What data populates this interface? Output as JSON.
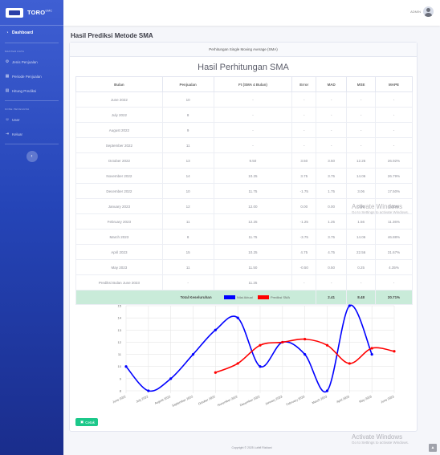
{
  "brand": {
    "name": "TORO",
    "suffix": "GMC"
  },
  "sidebar": {
    "dashboard": "Dashboard",
    "heading_master": "MASTER DATA",
    "items_master": [
      "Jenis Penjualan",
      "Periode Penjualan",
      "Hitung Prediksi"
    ],
    "heading_user": "KONE PENGGUNA",
    "items_user": [
      "User",
      "Keluar"
    ]
  },
  "topbar": {
    "user": "ADMIN"
  },
  "page_title": "Hasil Prediksi Metode SMA",
  "card": {
    "header": "Perhitungan Single Moving Average (SMA)",
    "title": "Hasil Perhitungan SMA"
  },
  "table": {
    "headers": [
      "Bulan",
      "Penjualan",
      "Ft (SMA 4 Bulan)",
      "Error",
      "MAD",
      "MSE",
      "MAPE"
    ],
    "rows": [
      [
        "June 2022",
        "10",
        "-",
        "-",
        "-",
        "-",
        "-"
      ],
      [
        "July 2022",
        "8",
        "-",
        "-",
        "-",
        "-",
        "-"
      ],
      [
        "August 2022",
        "9",
        "-",
        "-",
        "-",
        "-",
        "-"
      ],
      [
        "September 2022",
        "11",
        "-",
        "-",
        "-",
        "-",
        "-"
      ],
      [
        "October 2022",
        "13",
        "9.50",
        "3.50",
        "3.50",
        "12.25",
        "26.92%"
      ],
      [
        "November 2022",
        "14",
        "10.25",
        "3.75",
        "3.75",
        "14.06",
        "26.79%"
      ],
      [
        "December 2022",
        "10",
        "11.75",
        "-1.75",
        "1.75",
        "3.06",
        "17.50%"
      ],
      [
        "January 2023",
        "12",
        "12.00",
        "0.00",
        "0.00",
        "0.00",
        "0.00%"
      ],
      [
        "February 2023",
        "11",
        "12.25",
        "-1.25",
        "1.25",
        "1.56",
        "11.36%"
      ],
      [
        "March 2023",
        "8",
        "11.75",
        "-3.75",
        "3.75",
        "14.06",
        "46.88%"
      ],
      [
        "April 2023",
        "15",
        "10.25",
        "4.75",
        "4.75",
        "22.56",
        "31.67%"
      ],
      [
        "May 2023",
        "11",
        "11.50",
        "-0.50",
        "0.50",
        "0.25",
        "4.35%"
      ],
      [
        "Prediksi Bulan June 2023",
        "-",
        "11.25",
        "-",
        "-",
        "-",
        "-"
      ]
    ],
    "total": {
      "label": "Total Keseluruhan",
      "mad": "2.41",
      "mse": "8.48",
      "mape": "20.71%"
    }
  },
  "chart_data": {
    "type": "line",
    "x": [
      "June 2022",
      "July 2022",
      "August 2022",
      "September 2022",
      "October 2022",
      "November 2022",
      "December 2022",
      "January 2023",
      "February 2023",
      "March 2023",
      "April 2023",
      "May 2023",
      "June 2023"
    ],
    "series": [
      {
        "name": "Nilai Aktual",
        "color": "#0000ff",
        "values": [
          10,
          8,
          9,
          11,
          13,
          14,
          10,
          12,
          11,
          8,
          15,
          11,
          null
        ]
      },
      {
        "name": "Prediksi SMA",
        "color": "#ff0000",
        "values": [
          null,
          null,
          null,
          null,
          9.5,
          10.25,
          11.75,
          12,
          12.25,
          11.75,
          10.25,
          11.5,
          11.25
        ]
      }
    ],
    "ylim": [
      8,
      15
    ],
    "yticks": [
      "8",
      "9",
      "10",
      "11",
      "12",
      "13",
      "14",
      "15"
    ],
    "grid": true,
    "legend": "top"
  },
  "buttons": {
    "cetak": "Cetak"
  },
  "footer": "Copyright © 2025 Luthfi Rizkiani",
  "watermark": {
    "title": "Activate Windows",
    "sub": "Go to Settings to activate Windows."
  }
}
